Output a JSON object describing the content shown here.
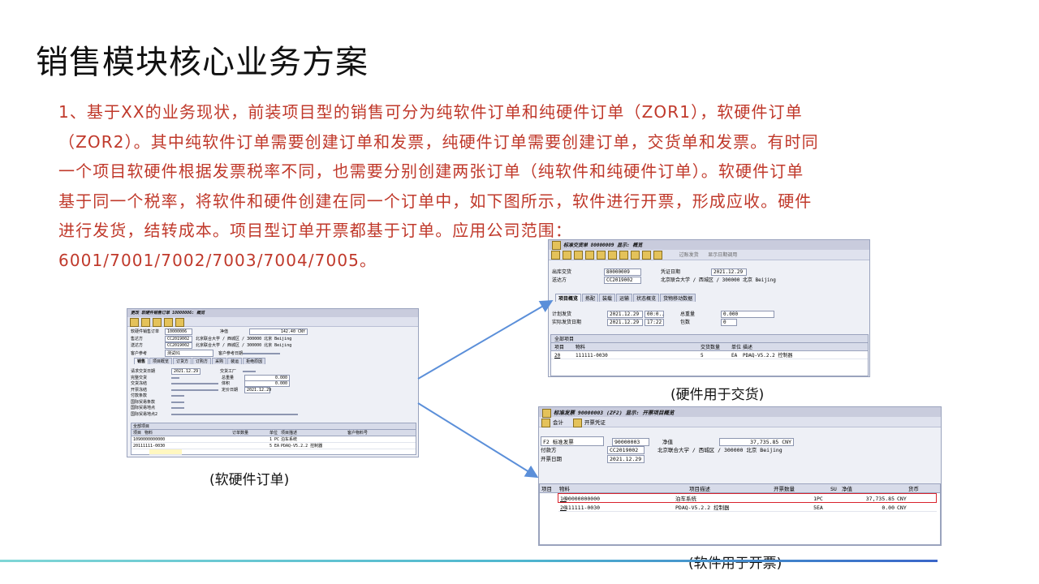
{
  "title": "销售模块核心业务方案",
  "paragraph_lines": [
    "1、基于XX的业务现状，前装项目型的销售可分为纯软件订单和纯硬件订单（ZOR1），软硬件订单",
    "（ZOR2）。其中纯软件订单需要创建订单和发票，纯硬件订单需要创建订单，交货单和发票。有时同",
    "一个项目软硬件根据发票税率不同，也需要分别创建两张订单（纯软件和纯硬件订单）。软硬件订单",
    "基于同一个税率，将软件和硬件创建在同一个订单中，如下图所示，软件进行开票，形成应收。硬件",
    "进行发货，结转成本。项目型订单开票都基于订单。应用公司范围：",
    "6001/7001/7002/7003/7004/7005。"
  ],
  "captions": {
    "order": "(软硬件订单)",
    "delivery": "(硬件用于交货)",
    "invoice": "(软件用于开票)"
  },
  "order_screen": {
    "title": "更改 软硬件销售订单 10000006: 概览",
    "fields": [
      {
        "label": "软硬件销售订单",
        "value": "10000006",
        "extra_label": "净值",
        "extra_value": "142.40 CNY"
      },
      {
        "label": "售达方",
        "value": "CC2019002",
        "extra_label": "北京联合大学 / 西城区 / 300000 北京 Beijing",
        "extra_value": ""
      },
      {
        "label": "送达方",
        "value": "CC2019002",
        "extra_label": "北京联合大学 / 西城区 / 300000 北京 Beijing",
        "extra_value": ""
      },
      {
        "label": "客户参考",
        "value": "测试01",
        "extra_label": "客户参考日期",
        "extra_value": ""
      }
    ],
    "tabs": [
      "销售",
      "项目概览",
      "订货方",
      "订购方",
      "采购",
      "装运",
      "拒绝原因"
    ],
    "detail": [
      {
        "label": "请求交货日期",
        "value": "2021.12.29",
        "extra_label": "交货工厂",
        "extra_value": ""
      },
      {
        "label": "完整交货",
        "value": "",
        "extra_label": "总重量",
        "extra_value": "0.000"
      },
      {
        "label": "交货冻结",
        "value": "",
        "extra_label": "体积",
        "extra_value": "0.000"
      },
      {
        "label": "开票冻结",
        "value": "",
        "extra_label": "定价日期",
        "extra_value": "2021.12.29"
      },
      {
        "label": "付款条款",
        "value": "",
        "extra_label": "",
        "extra_value": ""
      },
      {
        "label": "国际贸易条款",
        "value": "",
        "extra_label": "",
        "extra_value": ""
      },
      {
        "label": "国际贸易地点",
        "value": "",
        "extra_label": "",
        "extra_value": ""
      },
      {
        "label": "国际贸易地点2",
        "value": "",
        "extra_label": "",
        "extra_value": ""
      }
    ],
    "section": "全部项目",
    "columns": [
      "项目",
      "物料",
      "订单数量",
      "单位",
      "项目描述",
      "客户物料号"
    ],
    "rows": [
      [
        "10",
        "90000000000",
        "",
        "1 PC",
        "泊车系统",
        ""
      ],
      [
        "20",
        "111111-0030",
        "",
        "5 EA",
        "PDAQ-V5.2.2 控制器",
        ""
      ]
    ]
  },
  "delivery_screen": {
    "title": "标准交货单 80000009 显示: 概览",
    "toolbar": [
      "过账发货",
      "显示日期调用"
    ],
    "fields": [
      {
        "label": "出库交货",
        "value": "80000009",
        "extra_label": "凭证日期",
        "extra_value": "2021.12.29"
      },
      {
        "label": "送达方",
        "value": "CC2019002",
        "extra_label": "北京联合大学 / 西城区 / 300000 北京 Beijing",
        "extra_value": ""
      }
    ],
    "tabs": [
      "项目概览",
      "拣配",
      "装载",
      "运输",
      "状态概览",
      "货物移动数据"
    ],
    "detail": [
      {
        "label": "计划发货",
        "value": "2021.12.29",
        "time": "00:0..",
        "extra_label": "总重量",
        "extra_value": "0.000"
      },
      {
        "label": "实际发货日期",
        "value": "2021.12.29",
        "time": "17:22",
        "extra_label": "包数",
        "extra_value": "0"
      }
    ],
    "section": "全部项目",
    "columns": [
      "项目",
      "物料",
      "交货数量",
      "单位",
      "描述"
    ],
    "rows": [
      [
        "20",
        "111111-0030",
        "5",
        "EA",
        "PDAQ-V5.2.2 控制器"
      ]
    ]
  },
  "invoice_screen": {
    "title": "标准发票 90000003 (ZF2) 显示: 开票项目概览",
    "toolbar": [
      "会计",
      "开票凭证"
    ],
    "fields": [
      {
        "label": "F2 标准发票",
        "value": "90000003",
        "extra_label": "净值",
        "extra_value": "37,735.85 CNY"
      },
      {
        "label": "付款方",
        "value": "CC2019002",
        "extra_label": "北京联合大学 / 西城区 / 300000 北京 Beijing",
        "extra_value": ""
      },
      {
        "label": "开票日期",
        "value": "2021.12.29",
        "extra_label": "",
        "extra_value": ""
      }
    ],
    "columns": [
      "项目",
      "物料",
      "项目描述",
      "开票数量",
      "SU",
      "净值",
      "货币"
    ],
    "rows": [
      [
        "10",
        "90000000000",
        "泊车系统",
        "1",
        "PC",
        "37,735.85",
        "CNY"
      ],
      [
        "20",
        "111111-0030",
        "PDAQ-V5.2.2 控制器",
        "5",
        "EA",
        "0.00",
        "CNY"
      ]
    ]
  },
  "colors": {
    "paragraph": "#c0392b",
    "arrow": "#5b8fd9",
    "highlight": "#d9232d"
  }
}
